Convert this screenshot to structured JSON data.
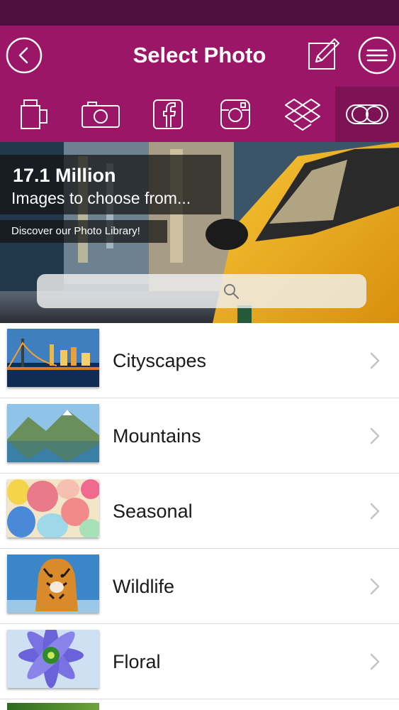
{
  "header": {
    "title": "Select Photo"
  },
  "source_tabs": [
    {
      "name": "cup-icon"
    },
    {
      "name": "camera-icon"
    },
    {
      "name": "facebook-icon"
    },
    {
      "name": "instagram-icon"
    },
    {
      "name": "dropbox-icon"
    },
    {
      "name": "toggle-icon"
    }
  ],
  "banner": {
    "title": "17.1 Million",
    "subtitle": "Images to choose from...",
    "cta": "Discover our Photo Library!",
    "search_placeholder": ""
  },
  "categories": [
    {
      "label": "Cityscapes"
    },
    {
      "label": "Mountains"
    },
    {
      "label": "Seasonal"
    },
    {
      "label": "Wildlife"
    },
    {
      "label": "Floral"
    }
  ],
  "colors": {
    "brand": "#9b1667",
    "status_bar": "#4f0f3e",
    "active_tab": "#7d1255"
  }
}
